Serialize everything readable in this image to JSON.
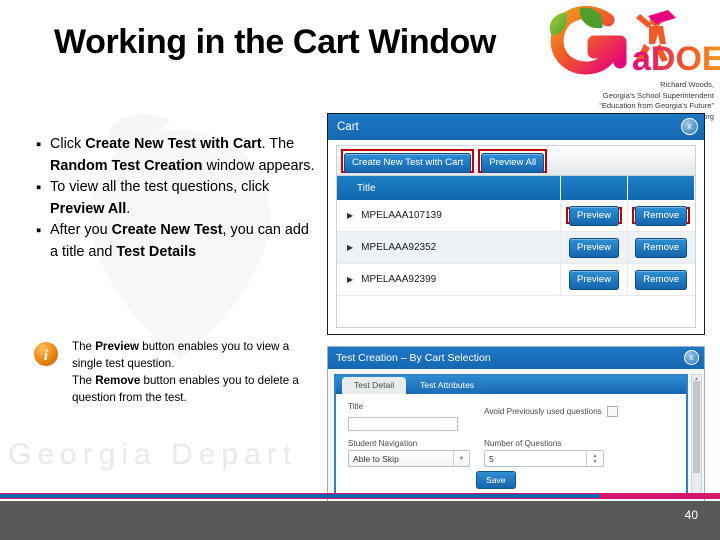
{
  "slide": {
    "title": "Working in the Cart Window",
    "page_number": "40",
    "watermark_text": "Georgia Depart",
    "accent_pink": "#d6176b",
    "accent_blue": "#1565ad",
    "footer_gray": "#595959",
    "highlight_red": "#c00000"
  },
  "branding": {
    "logo_name": "gadoe-peach-logo",
    "logo_text": "aDOE",
    "superintendent_name": "Richard Woods,",
    "superintendent_title": "Georgia's School Superintendent",
    "tagline": "“Education from Georgia’s Future”",
    "website": "www.gadoe.org"
  },
  "bullets": [
    {
      "marker": "▪",
      "parts": [
        {
          "t": "Click ",
          "b": false
        },
        {
          "t": "Create New Test with Cart",
          "b": true
        },
        {
          "t": ". The ",
          "b": false
        },
        {
          "t": "Random Test Creation",
          "b": true
        },
        {
          "t": " window appears.",
          "b": false
        }
      ]
    },
    {
      "marker": "▪",
      "parts": [
        {
          "t": "To view all the test questions, click ",
          "b": false
        },
        {
          "t": "Preview All",
          "b": true
        },
        {
          "t": ".",
          "b": false
        }
      ]
    },
    {
      "marker": "▪",
      "parts": [
        {
          "t": "After you ",
          "b": false
        },
        {
          "t": "Create New Test",
          "b": true
        },
        {
          "t": ", you can add a title and ",
          "b": false
        },
        {
          "t": "Test Details",
          "b": true
        }
      ]
    }
  ],
  "note": {
    "icon": "info-icon",
    "lines": [
      [
        {
          "t": "The ",
          "b": false
        },
        {
          "t": "Preview",
          "b": true
        },
        {
          "t": " button enables you to view a single test question.",
          "b": false
        }
      ],
      [
        {
          "t": "The ",
          "b": false
        },
        {
          "t": "Remove",
          "b": true
        },
        {
          "t": " button enables you to delete a question from the test.",
          "b": false
        }
      ]
    ]
  },
  "cart_window": {
    "title": "Cart",
    "close_label": "x",
    "toolbar": {
      "create_button": "Create New Test with Cart",
      "preview_all_button": "Preview All"
    },
    "columns": [
      "Title",
      "",
      ""
    ],
    "rows": [
      {
        "title": "MPELAAA107139",
        "preview": "Preview",
        "remove": "Remove"
      },
      {
        "title": "MPELAAA92352",
        "preview": "Preview",
        "remove": "Remove"
      },
      {
        "title": "MPELAAA92399",
        "preview": "Preview",
        "remove": "Remove"
      }
    ]
  },
  "test_creation_window": {
    "title": "Test Creation – By Cart Selection",
    "close_label": "x",
    "tabs": [
      {
        "label": "Test Detail",
        "active": true
      },
      {
        "label": "Test Attributes",
        "active": false
      }
    ],
    "fields": {
      "title_label": "Title",
      "title_value": "",
      "title_placeholder": "",
      "avoid_label": "Avoid Previously used questions",
      "avoid_checked": false,
      "student_nav_label": "Student Navigation",
      "student_nav_value": "Able to Skip",
      "num_questions_label": "Number of Questions",
      "num_questions_value": "5"
    },
    "save_button": "Save"
  }
}
